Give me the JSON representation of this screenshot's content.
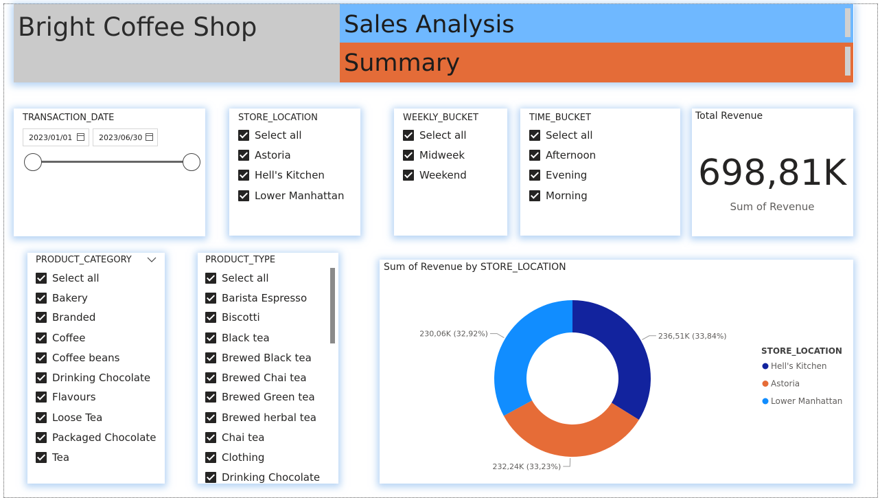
{
  "header": {
    "title": "Bright Coffee Shop",
    "subtitle": "Sales Analysis",
    "summary": "Summary"
  },
  "slicers": {
    "transaction_date": {
      "title": "TRANSACTION_DATE",
      "start": "2023/01/01",
      "end": "2023/06/30"
    },
    "store_location": {
      "title": "STORE_LOCATION",
      "items": [
        "Select all",
        "Astoria",
        "Hell's Kitchen",
        "Lower Manhattan"
      ]
    },
    "weekly_bucket": {
      "title": "WEEKLY_BUCKET",
      "items": [
        "Select all",
        "Midweek",
        "Weekend"
      ]
    },
    "time_bucket": {
      "title": "TIME_BUCKET",
      "items": [
        "Select all",
        "Afternoon",
        "Evening",
        "Morning"
      ]
    },
    "product_category": {
      "title": "PRODUCT_CATEGORY",
      "items": [
        "Select all",
        "Bakery",
        "Branded",
        "Coffee",
        "Coffee beans",
        "Drinking Chocolate",
        "Flavours",
        "Loose Tea",
        "Packaged Chocolate",
        "Tea"
      ]
    },
    "product_type": {
      "title": "PRODUCT_TYPE",
      "items": [
        "Select all",
        "Barista Espresso",
        "Biscotti",
        "Black tea",
        "Brewed Black tea",
        "Brewed Chai tea",
        "Brewed Green tea",
        "Brewed herbal tea",
        "Chai tea",
        "Clothing",
        "Drinking Chocolate"
      ]
    }
  },
  "kpi": {
    "title": "Total Revenue",
    "value": "698,81K",
    "label": "Sum of Revenue"
  },
  "chart_data": {
    "type": "pie",
    "title": "Sum of Revenue by STORE_LOCATION",
    "legend_title": "STORE_LOCATION",
    "legend_position": "right",
    "categories": [
      "Hell's Kitchen",
      "Astoria",
      "Lower Manhattan"
    ],
    "values": [
      236.51,
      232.24,
      230.06
    ],
    "percentages": [
      33.84,
      33.23,
      32.92
    ],
    "data_labels": [
      "236,51K (33,84%)",
      "232,24K (33,23%)",
      "230,06K (32,92%)"
    ],
    "colors": [
      "#12239e",
      "#e66c37",
      "#118dff"
    ]
  }
}
